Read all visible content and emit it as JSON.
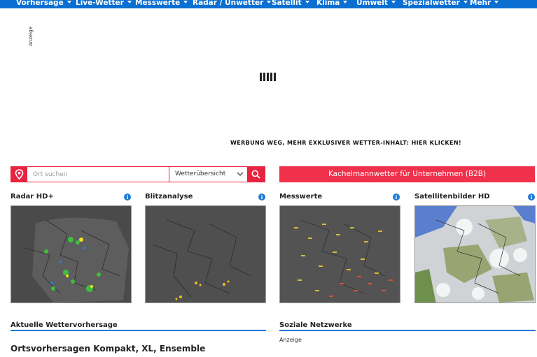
{
  "nav": {
    "items": [
      {
        "label": "Vorhersage"
      },
      {
        "label": "Live-Wetter"
      },
      {
        "label": "Messwerte"
      },
      {
        "label": "Radar / Unwetter"
      },
      {
        "label": "Satellit"
      },
      {
        "label": "Klima"
      },
      {
        "label": "Umwelt"
      },
      {
        "label": "Spezialwetter"
      },
      {
        "label": "Mehr"
      }
    ]
  },
  "ad": {
    "label": "Anzeige",
    "promo": "WERBUNG WEG, MEHR EXKLUSIVER WETTER-INHALT: HIER KLICKEN!"
  },
  "search": {
    "placeholder": "Ort suchen",
    "select_value": "Wetterübersicht"
  },
  "b2b_button": "Kachelmannwetter für Unternehmen (B2B)",
  "panels": [
    {
      "title": "Radar HD+"
    },
    {
      "title": "Blitzanalyse"
    },
    {
      "title": "Messwerte"
    },
    {
      "title": "Satellitenbilder HD"
    }
  ],
  "sections": {
    "forecast_title": "Aktuelle Wettervorhersage",
    "social_title": "Soziale Netzwerke",
    "social_ad": "Anzeige",
    "bottom_heading": "Ortsvorhersagen Kompakt, XL, Ensemble"
  },
  "colors": {
    "nav_bg": "#0b6fd1",
    "accent_red": "#e8233f",
    "section_line": "#1f7ad6",
    "info_blue": "#1f7ad6"
  }
}
